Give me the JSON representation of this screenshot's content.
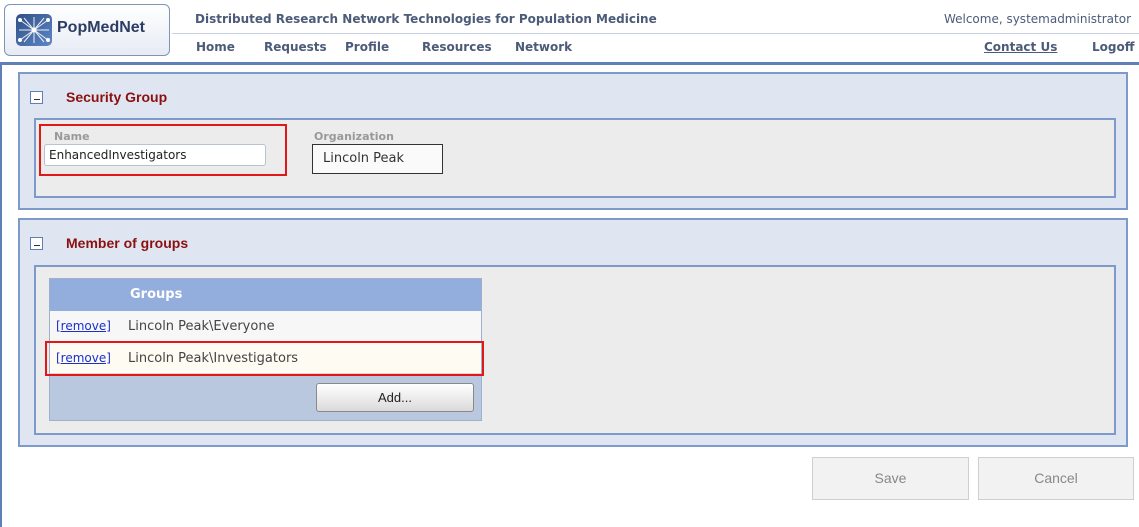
{
  "app": {
    "brand": "PopMedNet",
    "site_title": "Distributed Research Network Technologies for Population Medicine",
    "welcome": "Welcome, systemadministrator"
  },
  "nav": {
    "items": [
      "Home",
      "Requests",
      "Profile",
      "Resources",
      "Network"
    ],
    "contact": "Contact Us",
    "logoff": "Logoff"
  },
  "security_group": {
    "title": "Security Group",
    "name_label": "Name",
    "name_value": "EnhancedInvestigators",
    "org_label": "Organization",
    "org_value": "Lincoln Peak"
  },
  "member_groups": {
    "title": "Member of groups",
    "column_header": "Groups",
    "remove_label": "[remove]",
    "rows": [
      "Lincoln Peak\\Everyone",
      "Lincoln Peak\\Investigators"
    ],
    "add_label": "Add..."
  },
  "actions": {
    "save": "Save",
    "cancel": "Cancel"
  },
  "colors": {
    "panel_title": "#8b1010",
    "panel_border": "#7d9acb",
    "highlight": "#e01818",
    "link": "#1a2fd0"
  }
}
